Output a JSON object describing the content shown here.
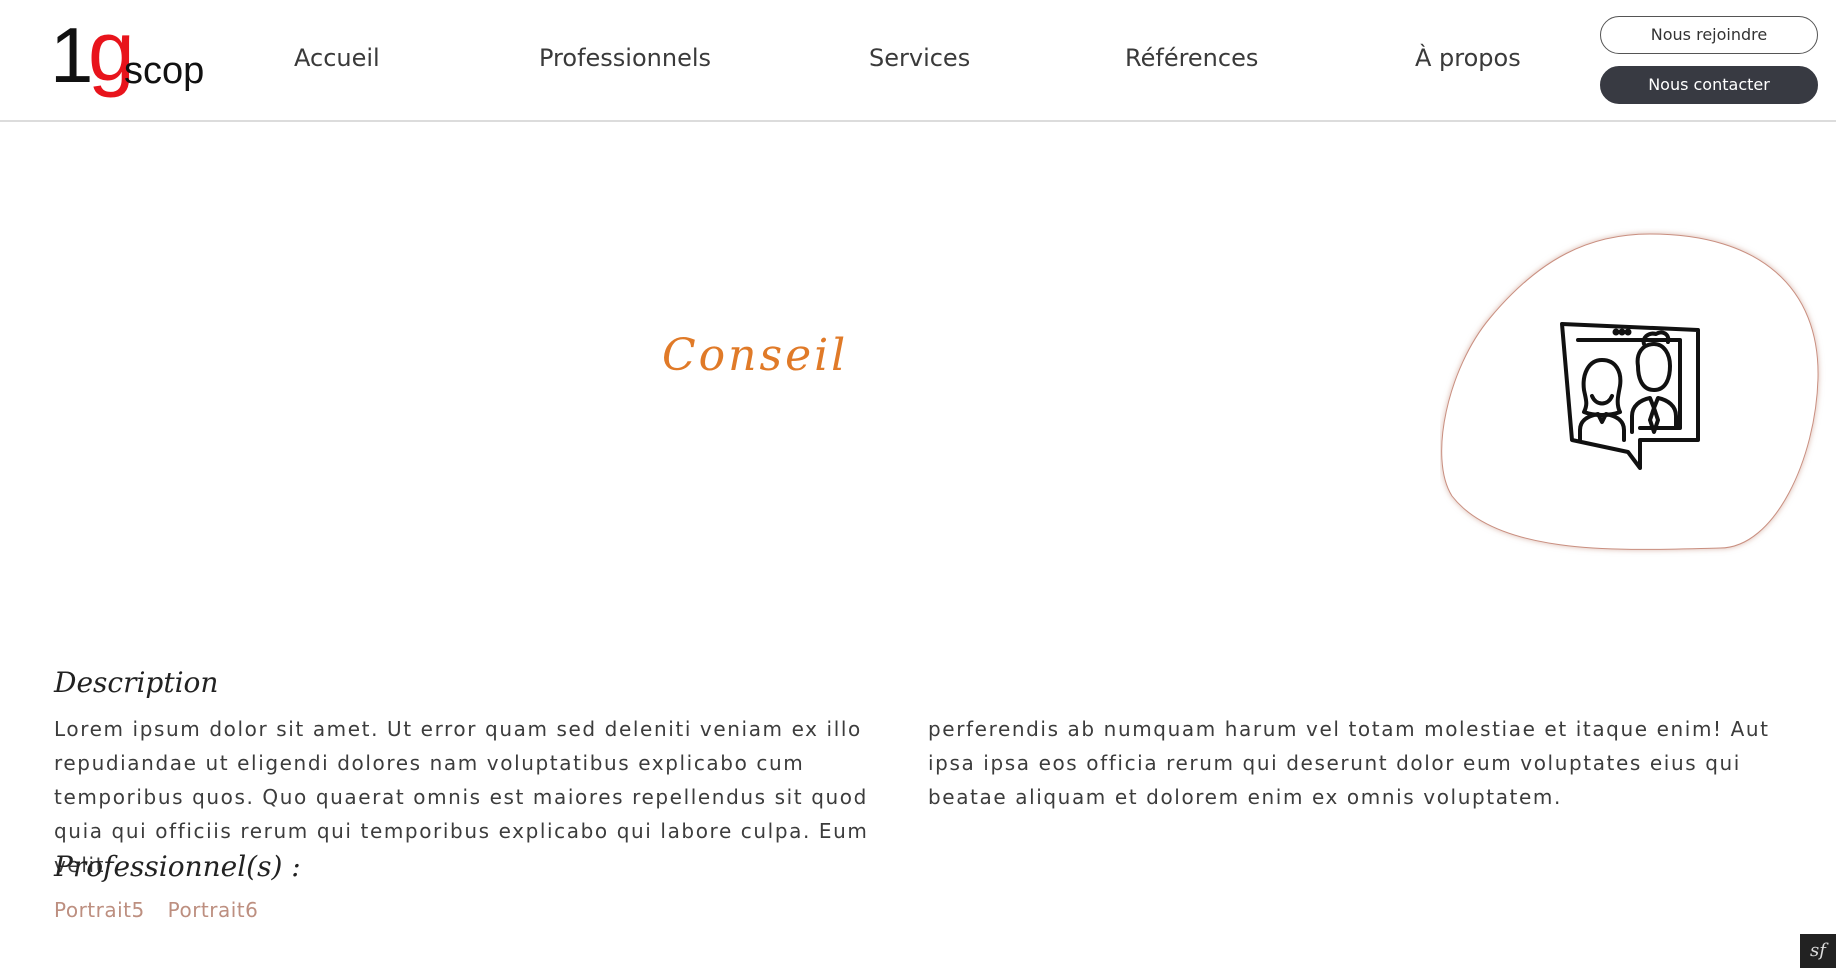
{
  "header": {
    "logo": {
      "one": "1",
      "g": "g",
      "scop": "scop"
    },
    "nav": [
      "Accueil",
      "Professionnels",
      "Services",
      "Références",
      "À propos"
    ],
    "join_label": "Nous rejoindre",
    "contact_label": "Nous contacter"
  },
  "main": {
    "title": "Conseil",
    "icon": "consultation-people-icon"
  },
  "description": {
    "heading": "Description",
    "col1": "Lorem ipsum dolor sit amet. Ut error quam sed deleniti veniam ex illo repudiandae ut eligendi dolores nam voluptatibus explicabo cum temporibus quos. Quo quaerat omnis est maiores repellendus sit quod quia qui officiis rerum qui temporibus explicabo qui labore culpa. Eum velit",
    "col2": "perferendis ab numquam harum vel totam molestiae et itaque enim! Aut ipsa ipsa eos officia rerum qui deserunt dolor eum voluptates eius qui beatae aliquam et dolorem enim ex omnis voluptatem."
  },
  "professionals": {
    "heading": "Professionnel(s) :",
    "links": [
      "Portrait5",
      "Portrait6"
    ]
  },
  "colors": {
    "accent": "#e07a28",
    "logo_red": "#e8141c",
    "link": "#bd8f80",
    "button_dark": "#383a42"
  }
}
